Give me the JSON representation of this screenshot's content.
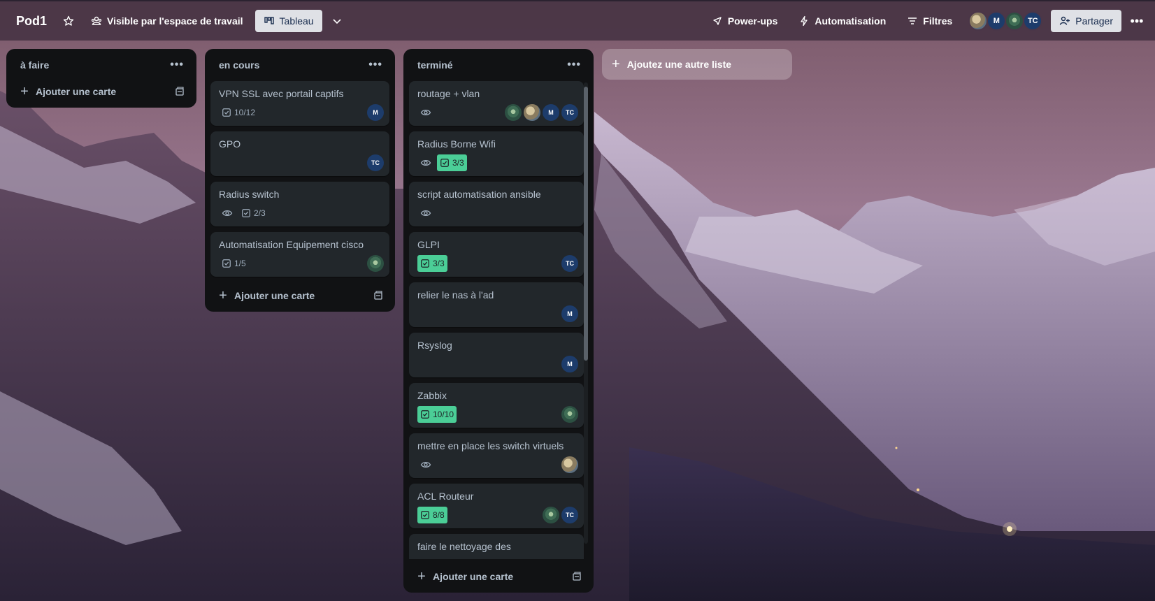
{
  "board": {
    "title": "Pod1",
    "visibility_label": "Visible par l'espace de travail",
    "view_label": "Tableau"
  },
  "header_right": {
    "powerups_label": "Power-ups",
    "automation_label": "Automatisation",
    "filters_label": "Filtres",
    "members": [
      {
        "initials": "",
        "type": "photo"
      },
      {
        "initials": "M",
        "type": "initials"
      },
      {
        "initials": "",
        "type": "alien"
      },
      {
        "initials": "TC",
        "type": "initials"
      }
    ],
    "share_label": "Partager",
    "more_icon": "ellipsis-icon"
  },
  "lists": [
    {
      "title": "à faire",
      "add_card_label": "Ajouter une carte",
      "cards": []
    },
    {
      "title": "en cours",
      "add_card_label": "Ajouter une carte",
      "cards": [
        {
          "title": "VPN SSL avec portail captifs",
          "watch": false,
          "checklist": "10/12",
          "complete": false,
          "members": [
            "M"
          ]
        },
        {
          "title": "GPO",
          "watch": false,
          "checklist": "",
          "complete": false,
          "members": [
            "TC"
          ]
        },
        {
          "title": "Radius switch",
          "watch": true,
          "checklist": "2/3",
          "complete": false,
          "members": []
        },
        {
          "title": "Automatisation Equipement cisco",
          "watch": false,
          "checklist": "1/5",
          "complete": false,
          "members": [
            "alien"
          ]
        }
      ]
    },
    {
      "title": "terminé",
      "add_card_label": "Ajouter une carte",
      "cards": [
        {
          "title": "routage + vlan",
          "watch": true,
          "checklist": "",
          "complete": false,
          "members": [
            "alien",
            "photo",
            "M",
            "TC"
          ]
        },
        {
          "title": "Radius Borne Wifi",
          "watch": true,
          "checklist": "3/3",
          "complete": true,
          "members": []
        },
        {
          "title": "script automatisation ansible",
          "watch": true,
          "checklist": "",
          "complete": false,
          "members": []
        },
        {
          "title": "GLPI",
          "watch": false,
          "checklist": "3/3",
          "complete": true,
          "members": [
            "TC"
          ]
        },
        {
          "title": "relier le nas à l'ad",
          "watch": false,
          "checklist": "",
          "complete": false,
          "members": [
            "M"
          ]
        },
        {
          "title": "Rsyslog",
          "watch": false,
          "checklist": "",
          "complete": false,
          "members": [
            "M"
          ]
        },
        {
          "title": "Zabbix",
          "watch": false,
          "checklist": "10/10",
          "complete": true,
          "members": [
            "alien"
          ]
        },
        {
          "title": "mettre en place les switch virtuels",
          "watch": true,
          "checklist": "",
          "complete": false,
          "members": [
            "photo"
          ]
        },
        {
          "title": "ACL Routeur",
          "watch": false,
          "checklist": "8/8",
          "complete": true,
          "members": [
            "alien",
            "TC"
          ]
        },
        {
          "title": "faire le nettoyage des",
          "watch": false,
          "checklist": "",
          "complete": false,
          "members": []
        }
      ]
    }
  ],
  "add_list_label": "Ajoutez une autre liste",
  "colors": {
    "header_bg": "#483444",
    "list_bg": "#111214",
    "card_bg": "#22272b",
    "complete_badge": "#4bce97",
    "avatar_bg": "#1d3c6b"
  }
}
